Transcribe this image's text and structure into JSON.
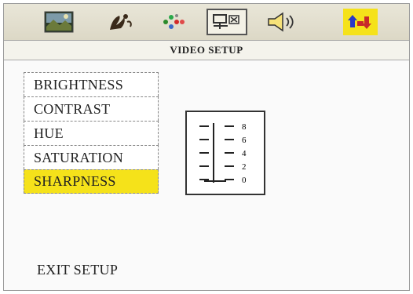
{
  "toolbar": {
    "icons": [
      {
        "name": "general-setup-icon"
      },
      {
        "name": "speaker-setup-icon"
      },
      {
        "name": "dolby-digital-icon"
      },
      {
        "name": "video-setup-icon",
        "active": true
      },
      {
        "name": "audio-setup-icon"
      },
      {
        "name": "preference-icon"
      }
    ]
  },
  "page": {
    "title": "VIDEO SETUP"
  },
  "menu": {
    "items": [
      {
        "label": "BRIGHTNESS"
      },
      {
        "label": "CONTRAST"
      },
      {
        "label": "HUE"
      },
      {
        "label": "SATURATION"
      },
      {
        "label": "SHARPNESS",
        "selected": true
      }
    ]
  },
  "slider": {
    "scale_labels": [
      "8",
      "6",
      "4",
      "2",
      "0"
    ],
    "current_value": 0
  },
  "footer": {
    "exit_label": "EXIT SETUP"
  },
  "colors": {
    "selected_highlight": "#f5e21a",
    "toolbar_bg": "#dcd8c6"
  }
}
